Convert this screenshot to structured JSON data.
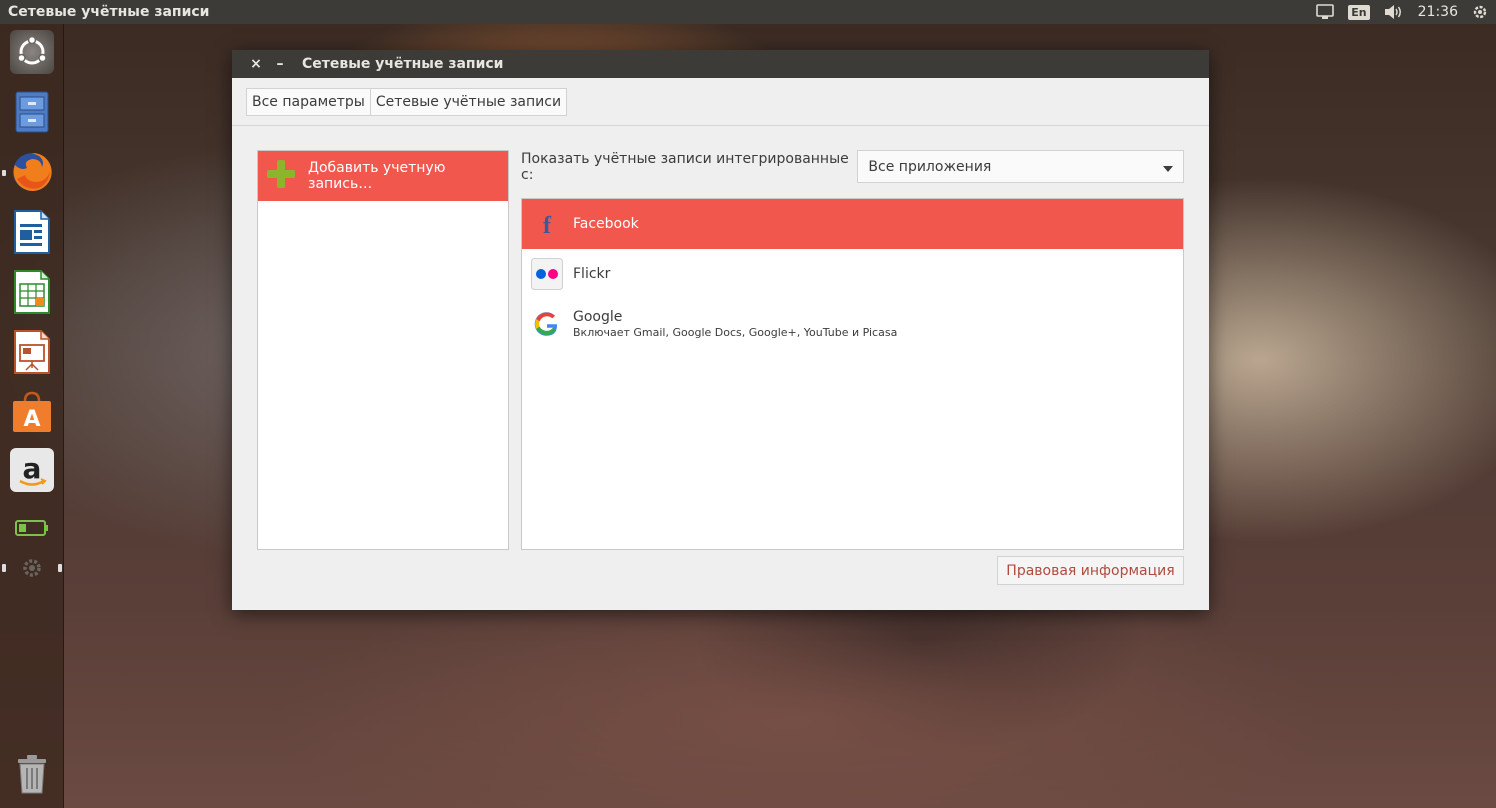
{
  "top_panel": {
    "title": "Сетевые учётные записи",
    "lang": "En",
    "clock": "21:36"
  },
  "launcher": {
    "items": [
      {
        "name": "ubuntu-dash-icon"
      },
      {
        "name": "files-icon"
      },
      {
        "name": "firefox-icon"
      },
      {
        "name": "writer-icon"
      },
      {
        "name": "calc-icon"
      },
      {
        "name": "impress-icon"
      },
      {
        "name": "software-center-icon"
      },
      {
        "name": "amazon-icon"
      },
      {
        "name": "battery-indicator-icon"
      },
      {
        "name": "settings-icon"
      },
      {
        "name": "trash-icon"
      }
    ]
  },
  "window": {
    "close_glyph": "×",
    "minimize_glyph": "–",
    "title": "Сетевые учётные записи",
    "breadcrumbs": [
      "Все параметры",
      "Сетевые учётные записи"
    ],
    "add_account_label": "Добавить учетную запись…",
    "filter_label": "Показать учётные записи интегрированные с:",
    "filter_value": "Все приложения",
    "providers": [
      {
        "name": "Facebook",
        "desc": "",
        "selected": true
      },
      {
        "name": "Flickr",
        "desc": "",
        "selected": false
      },
      {
        "name": "Google",
        "desc": "Включает Gmail, Google Docs, Google+, YouTube и Picasa",
        "selected": false
      }
    ],
    "legal_button": "Правовая информация"
  },
  "colors": {
    "accent": "#f2574e",
    "panel": "#3c3b37",
    "window_bg": "#efefef"
  }
}
